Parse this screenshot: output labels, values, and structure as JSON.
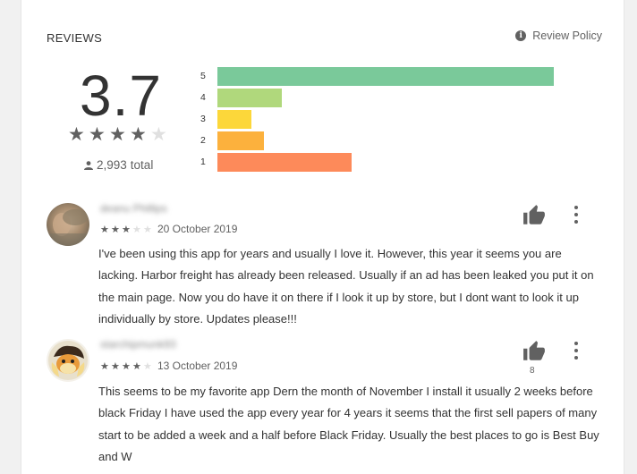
{
  "section": {
    "title": "REVIEWS",
    "policy_label": "Review Policy",
    "policy_icon": "info-icon"
  },
  "summary": {
    "average": "3.7",
    "star_fraction": 0.74,
    "total_count": "2,993",
    "total_suffix": "total",
    "person_icon": "person-icon"
  },
  "histogram": [
    {
      "label": "5",
      "fraction": 0.94,
      "color": "#7ac99a"
    },
    {
      "label": "4",
      "fraction": 0.18,
      "color": "#b0d87c"
    },
    {
      "label": "3",
      "fraction": 0.095,
      "color": "#fcd73a"
    },
    {
      "label": "2",
      "fraction": 0.13,
      "color": "#fcb13d"
    },
    {
      "label": "1",
      "fraction": 0.375,
      "color": "#fd8a5a"
    }
  ],
  "reviews": [
    {
      "author": "deanu Phillips",
      "stars": 3,
      "date": "20 October 2019",
      "text": "I've been using this app for years and usually I love it. However, this year it seems you are lacking. Harbor freight has already been released. Usually if an ad has been leaked you put it on the main page. Now you do have it on there if I look it up by store, but I dont want to look it up individually by store. Updates please!!!",
      "helpful_count": ""
    },
    {
      "author": "starchipmunk93",
      "stars": 4,
      "date": "13 October 2019",
      "text": "This seems to be my favorite app Dern the month of November I install it usually 2 weeks before black Friday I have used the app every year for 4 years it seems that the first sell papers of many start to be added a week and a half before Black Friday. Usually the best places to go is Best Buy and W",
      "helpful_count": "8"
    }
  ],
  "icons": {
    "thumb": "thumbs-up-icon",
    "more": "more-vert-icon",
    "star": "star-icon"
  },
  "colors": {
    "star_filled": "#616161",
    "star_empty": "#e0e0e0"
  }
}
